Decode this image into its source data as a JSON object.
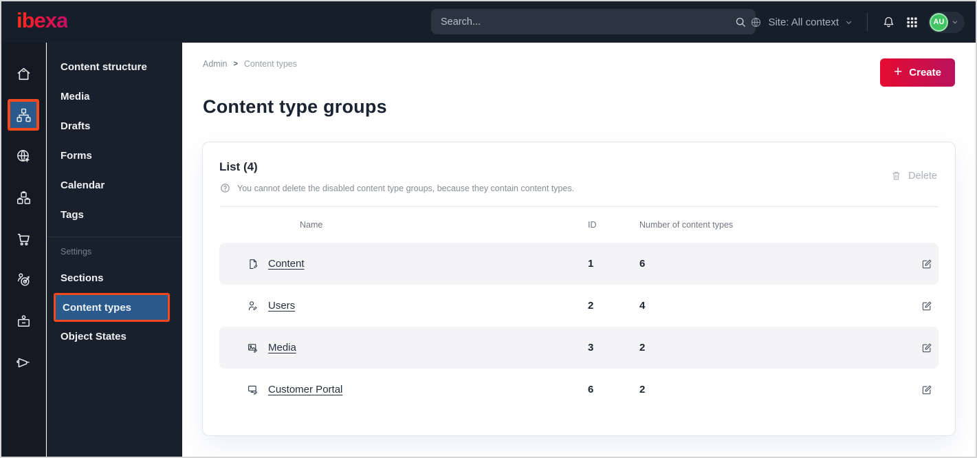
{
  "topbar": {
    "logo_text": "ibexa",
    "search_placeholder": "Search...",
    "site_context_label": "Site: All context",
    "avatar_initials": "AU"
  },
  "rail_items": [
    {
      "icon": "home-icon",
      "selected": false
    },
    {
      "icon": "content-structure-icon",
      "selected": true
    },
    {
      "icon": "site-globe-icon",
      "selected": false
    },
    {
      "icon": "products-boxes-icon",
      "selected": false
    },
    {
      "icon": "cart-icon",
      "selected": false
    },
    {
      "icon": "personalization-target-icon",
      "selected": false
    },
    {
      "icon": "admin-badge-icon",
      "selected": false
    },
    {
      "icon": "megaphone-icon",
      "selected": false
    }
  ],
  "sidebar": {
    "items": [
      "Content structure",
      "Media",
      "Drafts",
      "Forms",
      "Calendar",
      "Tags"
    ],
    "section_label": "Settings",
    "settings_items": [
      "Sections",
      "Content types",
      "Object States"
    ],
    "selected_item": "Content types"
  },
  "breadcrumb": {
    "items": [
      "Admin",
      "Content types"
    ],
    "separator": ">"
  },
  "page": {
    "title": "Content type groups",
    "create_label": "Create",
    "create_plus": "+"
  },
  "list": {
    "title": "List (4)",
    "info_text": "You cannot delete the disabled content type groups, because they contain content types.",
    "delete_label": "Delete",
    "columns": {
      "name": "Name",
      "id": "ID",
      "count": "Number of content types"
    },
    "rows": [
      {
        "icon": "content-file-icon",
        "name": "Content",
        "id": "1",
        "count": "6"
      },
      {
        "icon": "users-person-icon",
        "name": "Users",
        "id": "2",
        "count": "4"
      },
      {
        "icon": "media-image-icon",
        "name": "Media",
        "id": "3",
        "count": "2"
      },
      {
        "icon": "portal-monitor-icon",
        "name": "Customer Portal",
        "id": "6",
        "count": "2"
      }
    ]
  },
  "colors": {
    "topbar_bg": "#161e29",
    "selected_blue": "#2a5a8c",
    "accent_orange": "#f4481f",
    "create_gradient_start": "#e60b31",
    "create_gradient_end": "#b9125c",
    "avatar_green": "#43c464",
    "stripe_bg": "#f4f4f6"
  }
}
